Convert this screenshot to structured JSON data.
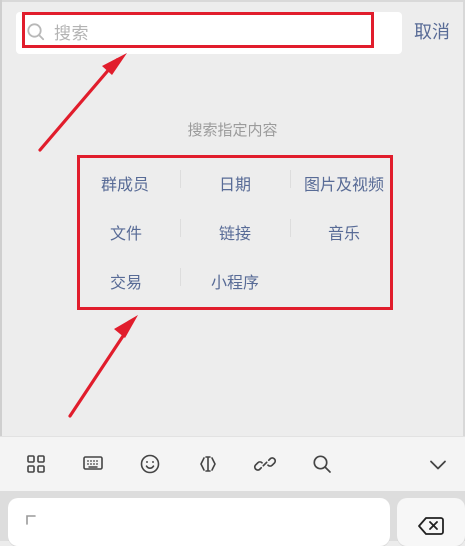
{
  "search": {
    "placeholder": "搜索",
    "cancel": "取消"
  },
  "hint": "搜索指定内容",
  "filters": {
    "items": [
      {
        "label": "群成员"
      },
      {
        "label": "日期"
      },
      {
        "label": "图片及视频"
      },
      {
        "label": "文件"
      },
      {
        "label": "链接"
      },
      {
        "label": "音乐"
      },
      {
        "label": "交易"
      },
      {
        "label": "小程序"
      }
    ]
  },
  "toolbar": {
    "icons": [
      "grid-icon",
      "keyboard-icon",
      "emoji-icon",
      "cursor-icon",
      "link-icon",
      "search-icon",
      "chevron-down-icon"
    ]
  },
  "colors": {
    "accent": "#586b96",
    "annotation": "#e11d2c",
    "hint": "#9b9b9b",
    "placeholder": "#b3b3b3"
  }
}
